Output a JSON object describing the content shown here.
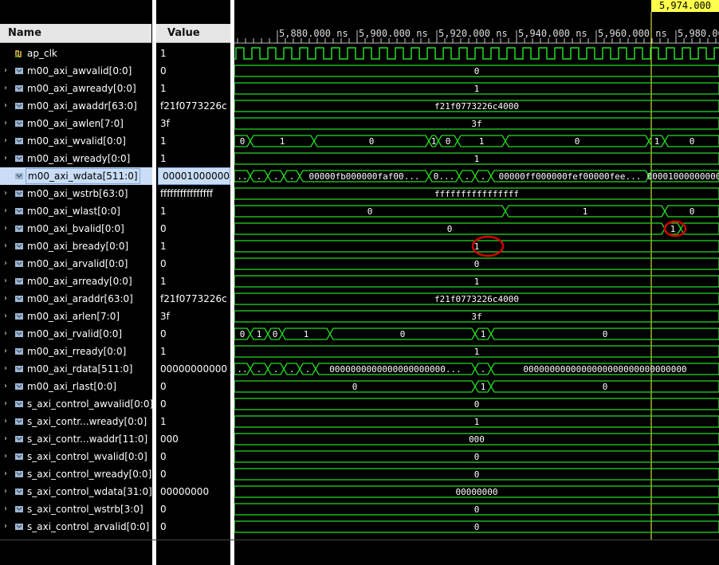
{
  "headers": {
    "name": "Name",
    "value": "Value"
  },
  "cursor_time": "5,974.000 ns",
  "timeline_ticks": [
    "5,880.000 ns",
    "5,900.000 ns",
    "5,920.000 ns",
    "5,940.000 ns",
    "5,960.000 ns",
    "5,980.000"
  ],
  "signals": [
    {
      "name": "ap_clk",
      "value": "1",
      "kind": "clock"
    },
    {
      "name": "m00_axi_awvalid[0:0]",
      "value": "0",
      "kind": "bus",
      "wave": [
        {
          "label": "0"
        }
      ]
    },
    {
      "name": "m00_axi_awready[0:0]",
      "value": "1",
      "kind": "bus",
      "wave": [
        {
          "label": "1"
        }
      ]
    },
    {
      "name": "m00_axi_awaddr[63:0]",
      "value": "f21f0773226c",
      "kind": "bus",
      "wave": [
        {
          "label": "f21f0773226c4000"
        }
      ]
    },
    {
      "name": "m00_axi_awlen[7:0]",
      "value": "3f",
      "kind": "bus",
      "wave": [
        {
          "label": "3f"
        }
      ]
    },
    {
      "name": "m00_axi_wvalid[0:0]",
      "value": "1",
      "kind": "bus",
      "wave": [
        {
          "t0": 0,
          "t1": 20,
          "label": "0"
        },
        {
          "t0": 20,
          "t1": 100,
          "label": "1"
        },
        {
          "t0": 100,
          "t1": 244,
          "label": "0"
        },
        {
          "t0": 244,
          "t1": 256,
          "label": "1"
        },
        {
          "t0": 256,
          "t1": 280,
          "label": "0"
        },
        {
          "t0": 280,
          "t1": 340,
          "label": "1"
        },
        {
          "t0": 340,
          "t1": 520,
          "label": "0"
        },
        {
          "t0": 520,
          "t1": 540,
          "label": "1"
        },
        {
          "t0": 540,
          "t1": 608,
          "label": "0"
        }
      ]
    },
    {
      "name": "m00_axi_wready[0:0]",
      "value": "1",
      "kind": "bus",
      "wave": [
        {
          "label": "1"
        }
      ]
    },
    {
      "name": "m00_axi_wdata[511:0]",
      "value": "00001000000",
      "kind": "bus",
      "selected": true,
      "wave": [
        {
          "t0": 0,
          "t1": 20,
          "label": ".."
        },
        {
          "t0": 20,
          "t1": 42,
          "label": "."
        },
        {
          "t0": 42,
          "t1": 62,
          "label": "."
        },
        {
          "t0": 62,
          "t1": 82,
          "label": "."
        },
        {
          "t0": 82,
          "t1": 244,
          "label": "00000fb000000faf00..."
        },
        {
          "t0": 244,
          "t1": 282,
          "label": "0..."
        },
        {
          "t0": 282,
          "t1": 302,
          "label": "."
        },
        {
          "t0": 302,
          "t1": 322,
          "label": "."
        },
        {
          "t0": 322,
          "t1": 520,
          "label": "00000ff000000fef00000fee..."
        },
        {
          "t0": 520,
          "t1": 608,
          "label": "00001000000000"
        }
      ]
    },
    {
      "name": "m00_axi_wstrb[63:0]",
      "value": "ffffffffffffffff",
      "kind": "bus",
      "wave": [
        {
          "label": "ffffffffffffffff"
        }
      ]
    },
    {
      "name": "m00_axi_wlast[0:0]",
      "value": "1",
      "kind": "bus",
      "wave": [
        {
          "t0": 0,
          "t1": 340,
          "label": "0"
        },
        {
          "t0": 340,
          "t1": 540,
          "label": "1"
        },
        {
          "t0": 540,
          "t1": 608,
          "label": "0"
        }
      ]
    },
    {
      "name": "m00_axi_bvalid[0:0]",
      "value": "0",
      "kind": "bus",
      "wave": [
        {
          "t0": 0,
          "t1": 540,
          "label": "0"
        },
        {
          "t0": 540,
          "t1": 560,
          "label": "1"
        },
        {
          "t0": 560,
          "t1": 608,
          "label": ""
        }
      ]
    },
    {
      "name": "m00_axi_bready[0:0]",
      "value": "1",
      "kind": "bus",
      "wave": [
        {
          "label": "1"
        }
      ]
    },
    {
      "name": "m00_axi_arvalid[0:0]",
      "value": "0",
      "kind": "bus",
      "wave": [
        {
          "label": "0"
        }
      ]
    },
    {
      "name": "m00_axi_arready[0:0]",
      "value": "1",
      "kind": "bus",
      "wave": [
        {
          "label": "1"
        }
      ]
    },
    {
      "name": "m00_axi_araddr[63:0]",
      "value": "f21f0773226c",
      "kind": "bus",
      "wave": [
        {
          "label": "f21f0773226c4000"
        }
      ]
    },
    {
      "name": "m00_axi_arlen[7:0]",
      "value": "3f",
      "kind": "bus",
      "wave": [
        {
          "label": "3f"
        }
      ]
    },
    {
      "name": "m00_axi_rvalid[0:0]",
      "value": "0",
      "kind": "bus",
      "wave": [
        {
          "t0": 0,
          "t1": 20,
          "label": "0"
        },
        {
          "t0": 20,
          "t1": 42,
          "label": "1"
        },
        {
          "t0": 42,
          "t1": 60,
          "label": "0"
        },
        {
          "t0": 60,
          "t1": 120,
          "label": "1"
        },
        {
          "t0": 120,
          "t1": 302,
          "label": "0"
        },
        {
          "t0": 302,
          "t1": 322,
          "label": "1"
        },
        {
          "t0": 322,
          "t1": 608,
          "label": "0"
        }
      ]
    },
    {
      "name": "m00_axi_rready[0:0]",
      "value": "1",
      "kind": "bus",
      "wave": [
        {
          "label": "1"
        }
      ]
    },
    {
      "name": "m00_axi_rdata[511:0]",
      "value": "00000000000",
      "kind": "bus",
      "wave": [
        {
          "t0": 0,
          "t1": 20,
          "label": ".."
        },
        {
          "t0": 20,
          "t1": 42,
          "label": "."
        },
        {
          "t0": 42,
          "t1": 62,
          "label": "."
        },
        {
          "t0": 62,
          "t1": 82,
          "label": "."
        },
        {
          "t0": 82,
          "t1": 102,
          "label": "."
        },
        {
          "t0": 102,
          "t1": 302,
          "label": "0000000000000000000000..."
        },
        {
          "t0": 302,
          "t1": 322,
          "label": "."
        },
        {
          "t0": 322,
          "t1": 608,
          "label": "0000000000000000000000000000000"
        }
      ]
    },
    {
      "name": "m00_axi_rlast[0:0]",
      "value": "0",
      "kind": "bus",
      "wave": [
        {
          "t0": 0,
          "t1": 302,
          "label": "0"
        },
        {
          "t0": 302,
          "t1": 322,
          "label": "1"
        },
        {
          "t0": 322,
          "t1": 608,
          "label": "0"
        }
      ]
    },
    {
      "name": "s_axi_control_awvalid[0:0]",
      "value": "0",
      "kind": "bus",
      "wave": [
        {
          "label": "0"
        }
      ]
    },
    {
      "name": "s_axi_contr...wready[0:0]",
      "value": "1",
      "kind": "bus",
      "wave": [
        {
          "label": "1"
        }
      ]
    },
    {
      "name": "s_axi_contr...waddr[11:0]",
      "value": "000",
      "kind": "bus",
      "wave": [
        {
          "label": "000"
        }
      ]
    },
    {
      "name": "s_axi_control_wvalid[0:0]",
      "value": "0",
      "kind": "bus",
      "wave": [
        {
          "label": "0"
        }
      ]
    },
    {
      "name": "s_axi_control_wready[0:0]",
      "value": "0",
      "kind": "bus",
      "wave": [
        {
          "label": "0"
        }
      ]
    },
    {
      "name": "s_axi_control_wdata[31:0]",
      "value": "00000000",
      "kind": "bus",
      "wave": [
        {
          "label": "00000000"
        }
      ]
    },
    {
      "name": "s_axi_control_wstrb[3:0]",
      "value": "0",
      "kind": "bus",
      "wave": [
        {
          "label": "0"
        }
      ]
    },
    {
      "name": "s_axi_control_arvalid[0:0]",
      "value": "0",
      "kind": "bus",
      "wave": [
        {
          "label": "0"
        }
      ]
    }
  ],
  "annotations": [
    {
      "signal": "m00_axi_bready[0:0]",
      "color": "#d00000"
    },
    {
      "signal": "m00_axi_bvalid[0:0]",
      "color": "#d00000"
    }
  ],
  "colors": {
    "wave": "#22dd22",
    "cursor": "#ffff4d",
    "selected_row": "#c9ddf6",
    "background": "#000000"
  }
}
